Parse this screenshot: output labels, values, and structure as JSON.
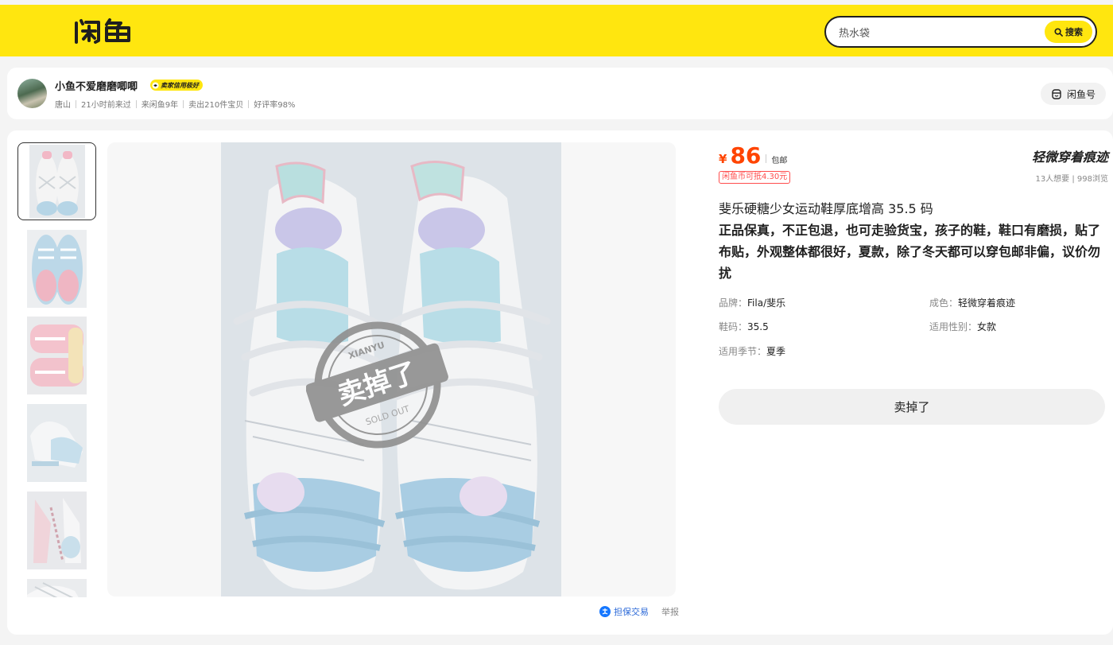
{
  "header": {
    "logo_text": "闲鱼",
    "search_value": "热水袋",
    "search_button": "搜索",
    "brand_color": "#ffe60f"
  },
  "seller": {
    "name": "小鱼不爱磨磨唧唧",
    "badge": "卖家信用极好",
    "meta": [
      "唐山",
      "21小时前来过",
      "来闲鱼9年",
      "卖出210件宝贝",
      "好评率98%"
    ],
    "id_button": "闲鱼号"
  },
  "gallery": {
    "thumbnail_count": 6,
    "active_index": 0,
    "stamp_text": "卖掉了",
    "stamp_sub": "SOLD OUT",
    "stamp_top": "XIANYU"
  },
  "links": {
    "guarantee": "担保交易",
    "report": "举报"
  },
  "item": {
    "currency": "¥",
    "price": "86",
    "shipping": "包邮",
    "coin_offer": "闲鱼币可抵4.30元",
    "condition": "轻微穿着痕迹",
    "stats": "13人想要 | 998浏览",
    "title": "斐乐硬糖少女运动鞋厚底增高 35.5 码",
    "description": "正品保真，不正包退，也可走验货宝，孩子的鞋，鞋口有磨损，贴了布贴，外观整体都很好，夏款，除了冬天都可以穿包邮非偏，议价勿扰",
    "attributes": [
      {
        "key": "品牌：",
        "value": "Fila/斐乐"
      },
      {
        "key": "成色：",
        "value": "轻微穿着痕迹"
      },
      {
        "key": "鞋码：",
        "value": "35.5"
      },
      {
        "key": "适用性别：",
        "value": "女款"
      },
      {
        "key": "适用季节：",
        "value": "夏季"
      }
    ],
    "status_button": "卖掉了",
    "price_color": "#ff4400"
  }
}
